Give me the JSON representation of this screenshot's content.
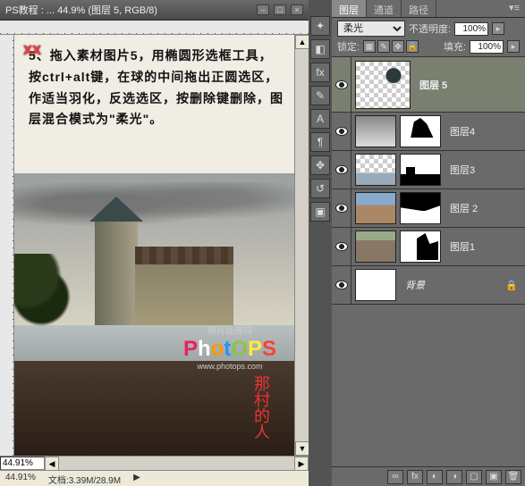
{
  "doc": {
    "title": "PS教程 : ... 44.9% (图层 5, RGB/8)",
    "watermark": "xx",
    "instruction": "5、拖入素材图片5，用椭圆形选框工具，按ctrl+alt键，在球的中间拖出正圆选区，作适当羽化，反选选区，按删除键删除，图层混合模式为\"柔光\"。",
    "logo_top": "照片处理网",
    "logo_text": "PhotOPS",
    "logo_url": "www.photops.com",
    "stamp": "那村的人",
    "zoom": "44.91%",
    "status_doc": "文档:3.39M/28.9M"
  },
  "tooltabs": [
    "图层",
    "通道",
    "路径"
  ],
  "layer_opts": {
    "opacity_label": "不透明度:",
    "opacity": "100%",
    "lock_label": "锁定:",
    "fill_label": "填充:",
    "fill": "100%",
    "blend_mode": "柔光"
  },
  "layers": [
    {
      "name": "图层 5",
      "selected": true,
      "hasMask": false
    },
    {
      "name": "图层4",
      "selected": false,
      "hasMask": true
    },
    {
      "name": "图层3",
      "selected": false,
      "hasMask": true
    },
    {
      "name": "图层 2",
      "selected": false,
      "hasMask": true
    },
    {
      "name": "图层1",
      "selected": false,
      "hasMask": true
    },
    {
      "name": "背景",
      "selected": false,
      "hasMask": false,
      "locked": true
    }
  ],
  "toolstrip_icons": [
    "navigator",
    "swatches",
    "styles",
    "brush",
    "char",
    "para",
    "move",
    "hand",
    "measure"
  ]
}
